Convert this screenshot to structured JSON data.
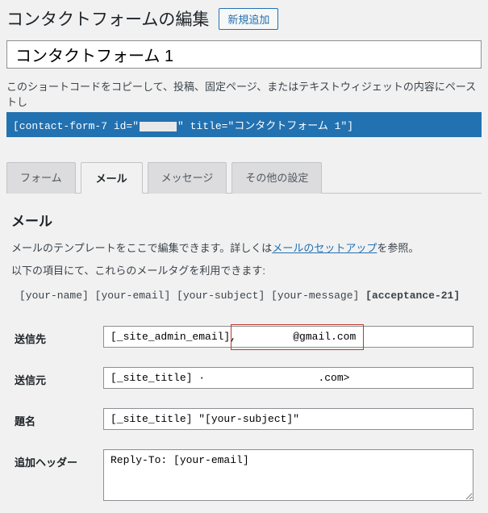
{
  "header": {
    "title": "コンタクトフォームの編集",
    "addNewLabel": "新規追加"
  },
  "formTitle": "コンタクトフォーム 1",
  "shortcode": {
    "hint": "このショートコードをコピーして、投稿、固定ページ、またはテキストウィジェットの内容にペーストし",
    "pre": "[contact-form-7 id=\"",
    "post": "\" title=\"コンタクトフォーム 1\"]"
  },
  "tabs": {
    "form": "フォーム",
    "mail": "メール",
    "messages": "メッセージ",
    "settings": "その他の設定"
  },
  "mailPanel": {
    "heading": "メール",
    "descPre": "メールのテンプレートをここで編集できます。詳しくは",
    "descLink": "メールのセットアップ",
    "descPost": "を参照。",
    "desc2": "以下の項目にて、これらのメールタグを利用できます:",
    "tags": {
      "t1": "[your-name]",
      "t2": "[your-email]",
      "t3": "[your-subject]",
      "t4": "[your-message]",
      "t5": "[acceptance-21]"
    },
    "labels": {
      "to": "送信先",
      "from": "送信元",
      "subject": "題名",
      "headers": "追加ヘッダー"
    },
    "values": {
      "to": "[_site_admin_email],         @gmail.com",
      "from": "[_site_title] ·                  .com>",
      "subject": "[_site_title] \"[your-subject]\"",
      "headers": "Reply-To: [your-email]"
    }
  }
}
